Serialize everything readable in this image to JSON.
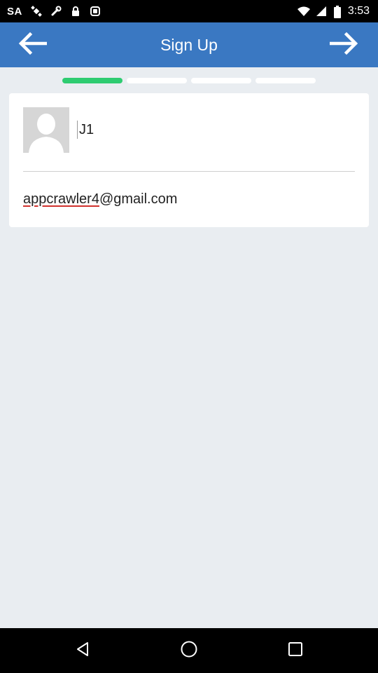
{
  "status_bar": {
    "carrier": "SA",
    "time": "3:53",
    "icons": [
      "satellite-icon",
      "wrench-icon",
      "lock-icon",
      "notification-icon",
      "wifi-icon",
      "signal-icon",
      "battery-icon"
    ]
  },
  "app_bar": {
    "title": "Sign Up",
    "back_icon": "arrow-left-icon",
    "forward_icon": "arrow-right-icon"
  },
  "progress": {
    "total_steps": 4,
    "current_step": 1,
    "active_color": "#2ecc71",
    "inactive_color": "#ffffff"
  },
  "form": {
    "name_value": "J1",
    "email_value_misspelled": "appcrawler4",
    "email_value_rest": "@gmail.com",
    "avatar_icon": "user-silhouette-icon"
  },
  "colors": {
    "app_bar": "#3a78c2",
    "background": "#e9edf1",
    "spellcheck_underline": "#d0312d"
  },
  "nav_bar": {
    "buttons": [
      "back-triangle-icon",
      "home-circle-icon",
      "recents-square-icon"
    ]
  }
}
